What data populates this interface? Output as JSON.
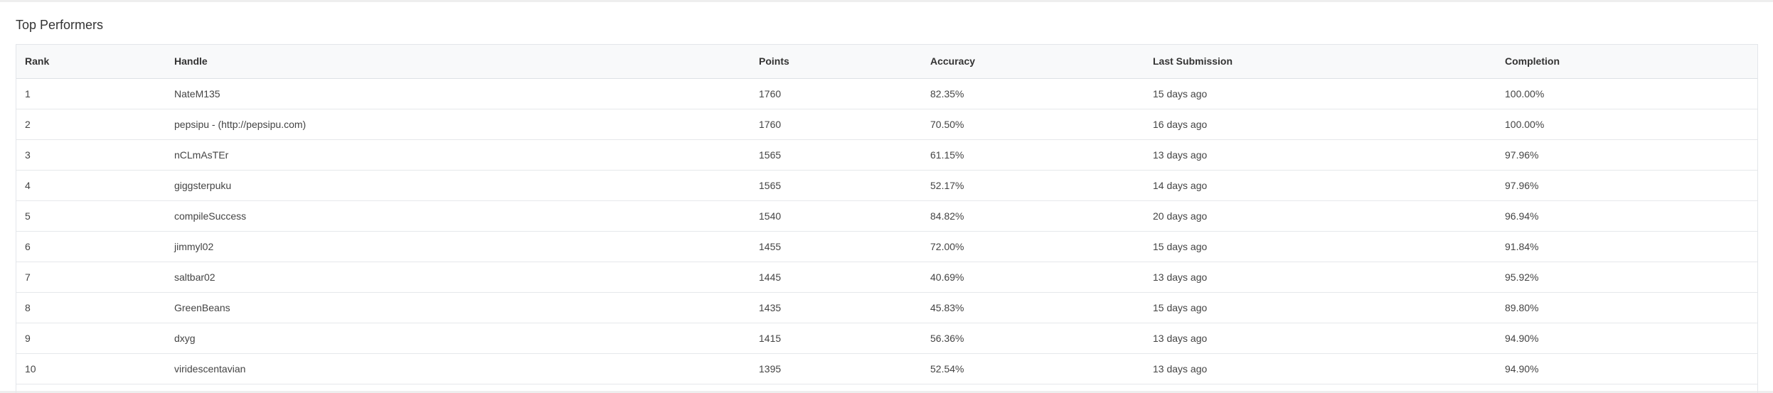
{
  "panel": {
    "title": "Top Performers"
  },
  "table": {
    "headers": {
      "rank": "Rank",
      "handle": "Handle",
      "points": "Points",
      "accuracy": "Accuracy",
      "last_submission": "Last Submission",
      "completion": "Completion"
    },
    "rows": [
      {
        "rank": "1",
        "handle": "NateM135",
        "points": "1760",
        "accuracy": "82.35%",
        "last_submission": "15 days ago",
        "completion": "100.00%"
      },
      {
        "rank": "2",
        "handle": "pepsipu - (http://pepsipu.com)",
        "points": "1760",
        "accuracy": "70.50%",
        "last_submission": "16 days ago",
        "completion": "100.00%"
      },
      {
        "rank": "3",
        "handle": "nCLmAsTEr",
        "points": "1565",
        "accuracy": "61.15%",
        "last_submission": "13 days ago",
        "completion": "97.96%"
      },
      {
        "rank": "4",
        "handle": "giggsterpuku",
        "points": "1565",
        "accuracy": "52.17%",
        "last_submission": "14 days ago",
        "completion": "97.96%"
      },
      {
        "rank": "5",
        "handle": "compileSuccess",
        "points": "1540",
        "accuracy": "84.82%",
        "last_submission": "20 days ago",
        "completion": "96.94%"
      },
      {
        "rank": "6",
        "handle": "jimmyl02",
        "points": "1455",
        "accuracy": "72.00%",
        "last_submission": "15 days ago",
        "completion": "91.84%"
      },
      {
        "rank": "7",
        "handle": "saltbar02",
        "points": "1445",
        "accuracy": "40.69%",
        "last_submission": "13 days ago",
        "completion": "95.92%"
      },
      {
        "rank": "8",
        "handle": "GreenBeans",
        "points": "1435",
        "accuracy": "45.83%",
        "last_submission": "15 days ago",
        "completion": "89.80%"
      },
      {
        "rank": "9",
        "handle": "dxyg",
        "points": "1415",
        "accuracy": "56.36%",
        "last_submission": "13 days ago",
        "completion": "94.90%"
      },
      {
        "rank": "10",
        "handle": "viridescentavian",
        "points": "1395",
        "accuracy": "52.54%",
        "last_submission": "13 days ago",
        "completion": "94.90%"
      }
    ]
  }
}
